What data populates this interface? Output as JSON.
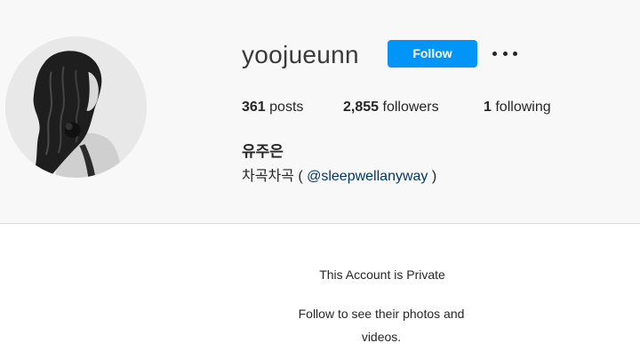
{
  "profile": {
    "username": "yoojueunn",
    "follow_label": "Follow",
    "more_icon": "more-horizontal-icon",
    "avatar_icon": "profile-photo",
    "stats": {
      "posts_count": "361",
      "posts_label": "posts",
      "followers_count": "2,855",
      "followers_label": "followers",
      "following_count": "1",
      "following_label": "following"
    },
    "full_name": "유주은",
    "bio": {
      "text_before": "차곡차곡 ( ",
      "mention": "@sleepwellanyway",
      "text_after": " )"
    }
  },
  "private_notice": {
    "title": "This Account is Private",
    "subtitle": "Follow to see their photos and videos."
  },
  "colors": {
    "accent": "#0095f6",
    "header_background": "#f8f8f8",
    "mention": "#00376b",
    "text": "#262626"
  }
}
